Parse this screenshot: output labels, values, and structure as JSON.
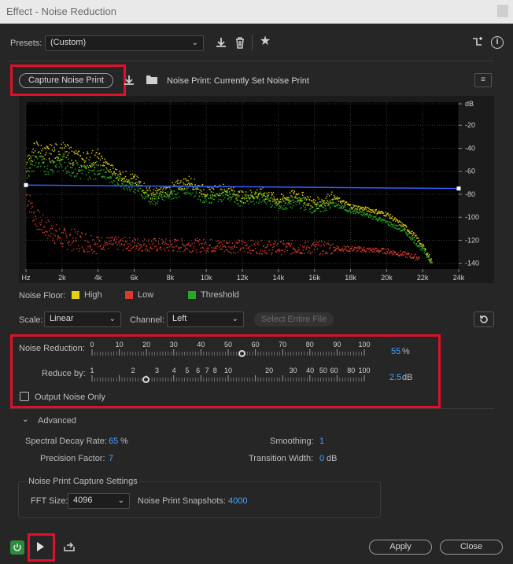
{
  "window": {
    "title": "Effect - Noise Reduction"
  },
  "presets": {
    "label": "Presets:",
    "value": "(Custom)"
  },
  "capture": {
    "button": "Capture Noise Print",
    "status": "Noise Print: Currently Set Noise Print"
  },
  "chart_data": {
    "type": "line",
    "title": "",
    "x_ticks": [
      "Hz",
      "2k",
      "4k",
      "6k",
      "8k",
      "10k",
      "12k",
      "14k",
      "16k",
      "18k",
      "20k",
      "22k",
      "24k"
    ],
    "y_ticks": [
      "dB",
      "-20",
      "-40",
      "-60",
      "-80",
      "-100",
      "-120",
      "-140"
    ],
    "xlim": [
      0,
      24000
    ],
    "ylim": [
      -145,
      0
    ],
    "series": [
      {
        "name": "High",
        "color": "#e3d20f",
        "x": [
          0,
          500,
          1000,
          2000,
          3000,
          4000,
          5000,
          6000,
          7000,
          8000,
          9000,
          10000,
          11000,
          12000,
          13000,
          14000,
          15000,
          16000,
          17000,
          18000,
          19000,
          20000,
          21000,
          21500,
          22000,
          22500
        ],
        "y": [
          -55,
          -40,
          -45,
          -42,
          -50,
          -48,
          -62,
          -67,
          -80,
          -75,
          -68,
          -78,
          -75,
          -82,
          -78,
          -85,
          -80,
          -88,
          -82,
          -90,
          -93,
          -97,
          -108,
          -115,
          -125,
          -138
        ]
      },
      {
        "name": "Low",
        "color": "#d83a2e",
        "x": [
          0,
          500,
          1000,
          2000,
          3000,
          4000,
          6000,
          8000,
          10000,
          12000,
          14000,
          16000,
          18000,
          20000,
          21000,
          21800
        ],
        "y": [
          -80,
          -100,
          -108,
          -118,
          -120,
          -122,
          -123,
          -124,
          -124,
          -125,
          -126,
          -126,
          -127,
          -129,
          -132,
          -135
        ]
      },
      {
        "name": "Threshold",
        "color": "#28a828",
        "x": [
          0,
          500,
          1000,
          2000,
          3000,
          4000,
          5000,
          6000,
          7000,
          8000,
          9000,
          10000,
          11000,
          12000,
          13000,
          14000,
          15000,
          16000,
          17000,
          18000,
          19000,
          20000,
          21000,
          21500,
          22000,
          22500
        ],
        "y": [
          -60,
          -50,
          -55,
          -52,
          -60,
          -58,
          -68,
          -73,
          -85,
          -80,
          -74,
          -84,
          -80,
          -86,
          -82,
          -90,
          -86,
          -92,
          -88,
          -94,
          -98,
          -104,
          -112,
          -120,
          -128,
          -140
        ]
      }
    ],
    "threshold_line": {
      "x": [
        0,
        24000
      ],
      "y": [
        -72,
        -75
      ],
      "color": "#3060ff"
    }
  },
  "legend": {
    "label": "Noise Floor:",
    "items": [
      {
        "name": "High",
        "color": "#e3d20f"
      },
      {
        "name": "Low",
        "color": "#d83a2e"
      },
      {
        "name": "Threshold",
        "color": "#28a828"
      }
    ]
  },
  "scale": {
    "label": "Scale:",
    "value": "Linear"
  },
  "channel": {
    "label": "Channel:",
    "value": "Left"
  },
  "select_entire_file": "Select Entire File",
  "noise_reduction": {
    "label": "Noise Reduction:",
    "value": "55",
    "unit": "%",
    "fraction": 0.55,
    "ticks": [
      "0",
      "10",
      "20",
      "30",
      "40",
      "50",
      "60",
      "70",
      "80",
      "90",
      "100"
    ]
  },
  "reduce_by": {
    "label": "Reduce by:",
    "value": "2.5",
    "unit": "dB",
    "ticks": [
      "1",
      "2",
      "3",
      "4",
      "5",
      "6",
      "7",
      "8",
      "10",
      "20",
      "30",
      "40",
      "50",
      "60",
      "80",
      "100"
    ]
  },
  "output_noise_only": {
    "label": "Output Noise Only",
    "checked": false
  },
  "advanced": {
    "label": "Advanced",
    "spectral_decay": {
      "label": "Spectral Decay Rate:",
      "value": "65",
      "unit": "%"
    },
    "smoothing": {
      "label": "Smoothing:",
      "value": "1"
    },
    "precision": {
      "label": "Precision Factor:",
      "value": "7"
    },
    "transition": {
      "label": "Transition Width:",
      "value": "0",
      "unit": "dB"
    }
  },
  "capture_settings": {
    "title": "Noise Print Capture Settings",
    "fft_label": "FFT Size:",
    "fft_value": "4096",
    "snapshots_label": "Noise Print Snapshots:",
    "snapshots_value": "4000"
  },
  "footer": {
    "apply": "Apply",
    "close": "Close"
  }
}
